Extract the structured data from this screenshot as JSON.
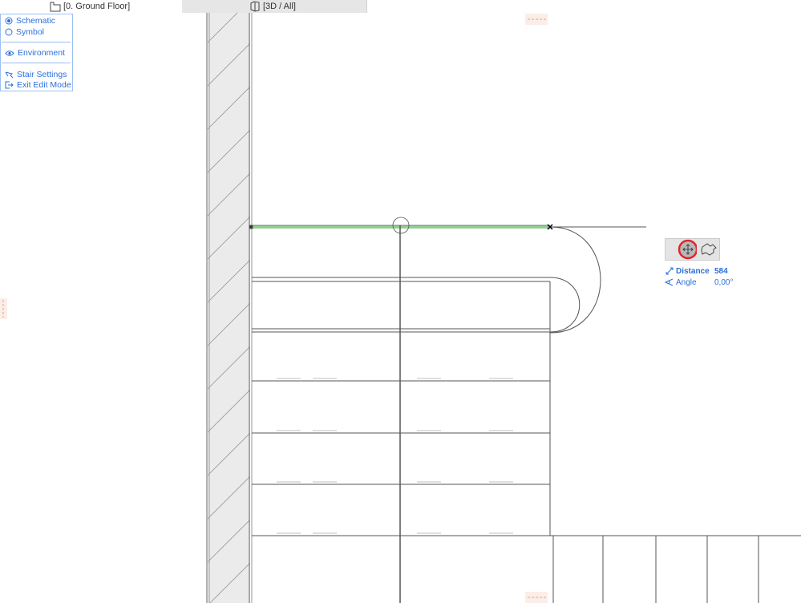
{
  "tabs": [
    {
      "label": "[0. Ground Floor]",
      "icon": "floor-plan-icon"
    },
    {
      "label": "[3D / All]",
      "icon": "3d-box-icon"
    }
  ],
  "palette": {
    "view_options": [
      {
        "label": "Schematic",
        "selected": true
      },
      {
        "label": "Symbol",
        "selected": false
      }
    ],
    "environment": "Environment",
    "stair_settings": "Stair Settings",
    "exit_edit_mode": "Exit Edit Mode"
  },
  "pet_palette": {
    "buttons": [
      {
        "icon": "move-icon",
        "active": true
      },
      {
        "icon": "stair-edit-icon",
        "active": false
      }
    ]
  },
  "tracker": {
    "rows": [
      {
        "label": "Distance",
        "value": "584",
        "icon": "distance-icon"
      },
      {
        "label": "Angle",
        "value": "0,00°",
        "icon": "angle-icon"
      }
    ]
  },
  "colors": {
    "accent": "#2a6fdb",
    "highlight": "#8fd08f",
    "active_ring": "#e0262b"
  }
}
